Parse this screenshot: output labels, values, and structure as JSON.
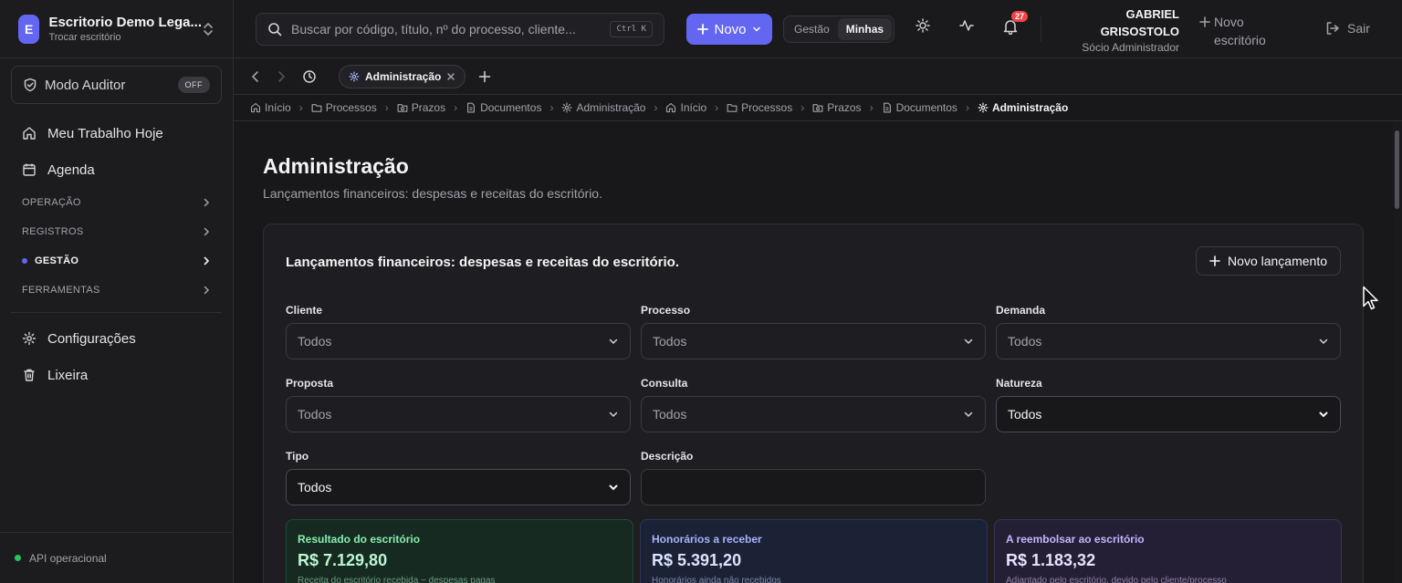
{
  "org": {
    "initial": "E",
    "name": "Escritorio Demo Lega...",
    "switch_label": "Trocar escritório"
  },
  "auditor": {
    "label": "Modo Auditor",
    "state": "OFF"
  },
  "sidebar": {
    "main_items": [
      {
        "label": "Meu Trabalho Hoje",
        "icon": "home-icon"
      },
      {
        "label": "Agenda",
        "icon": "calendar-icon"
      }
    ],
    "sections": [
      {
        "label": "OPERAÇÃO",
        "active": false
      },
      {
        "label": "REGISTROS",
        "active": false
      },
      {
        "label": "GESTÃO",
        "active": true
      },
      {
        "label": "FERRAMENTAS",
        "active": false
      }
    ],
    "bottom_items": [
      {
        "label": "Configurações",
        "icon": "gear-icon"
      },
      {
        "label": "Lixeira",
        "icon": "trash-icon"
      }
    ],
    "status": "API operacional"
  },
  "topbar": {
    "search_placeholder": "Buscar por código, título, nº do processo, cliente...",
    "shortcut": "Ctrl K",
    "new_label": "Novo",
    "seg_options": [
      "Gestão",
      "Minhas"
    ],
    "seg_selected": "Minhas",
    "notifications": "27",
    "user_first": "GABRIEL",
    "user_last": "GRISOSTOLO",
    "user_role": "Sócio Administrador",
    "new_office": "Novo escritório",
    "logout": "Sair"
  },
  "tabs": [
    {
      "label": "Administração",
      "active": true
    }
  ],
  "breadcrumb": [
    "Início",
    "Processos",
    "Prazos",
    "Documentos",
    "Administração",
    "Início",
    "Processos",
    "Prazos",
    "Documentos",
    "Administração"
  ],
  "page": {
    "title": "Administração",
    "subtitle": "Lançamentos financeiros: despesas e receitas do escritório.",
    "card_title": "Lançamentos financeiros: despesas e receitas do escritório.",
    "new_launch": "Novo lançamento"
  },
  "filters": {
    "cliente": {
      "label": "Cliente",
      "value": "Todos"
    },
    "processo": {
      "label": "Processo",
      "value": "Todos"
    },
    "demanda": {
      "label": "Demanda",
      "value": "Todos"
    },
    "proposta": {
      "label": "Proposta",
      "value": "Todos"
    },
    "consulta": {
      "label": "Consulta",
      "value": "Todos"
    },
    "natureza": {
      "label": "Natureza",
      "value": "Todos"
    },
    "tipo": {
      "label": "Tipo",
      "value": "Todos"
    },
    "descricao": {
      "label": "Descrição",
      "value": ""
    }
  },
  "stats": [
    {
      "label": "Resultado do escritório",
      "value": "R$ 7.129,80",
      "note": "Receita do escritório recebida − despesas pagas",
      "color": "#86efac"
    },
    {
      "label": "Honorários a receber",
      "value": "R$ 5.391,20",
      "note": "Honorários ainda não recebidos",
      "color": "#a5b4fc"
    },
    {
      "label": "A reembolsar ao escritório",
      "value": "R$ 1.183,32",
      "note": "Adiantado pelo escritório, devido pelo cliente/processo",
      "color": "#c4b5fd"
    }
  ],
  "colors": {
    "accent": "#6366f1",
    "status_ok": "#22c55e",
    "notification": "#ef4444"
  }
}
